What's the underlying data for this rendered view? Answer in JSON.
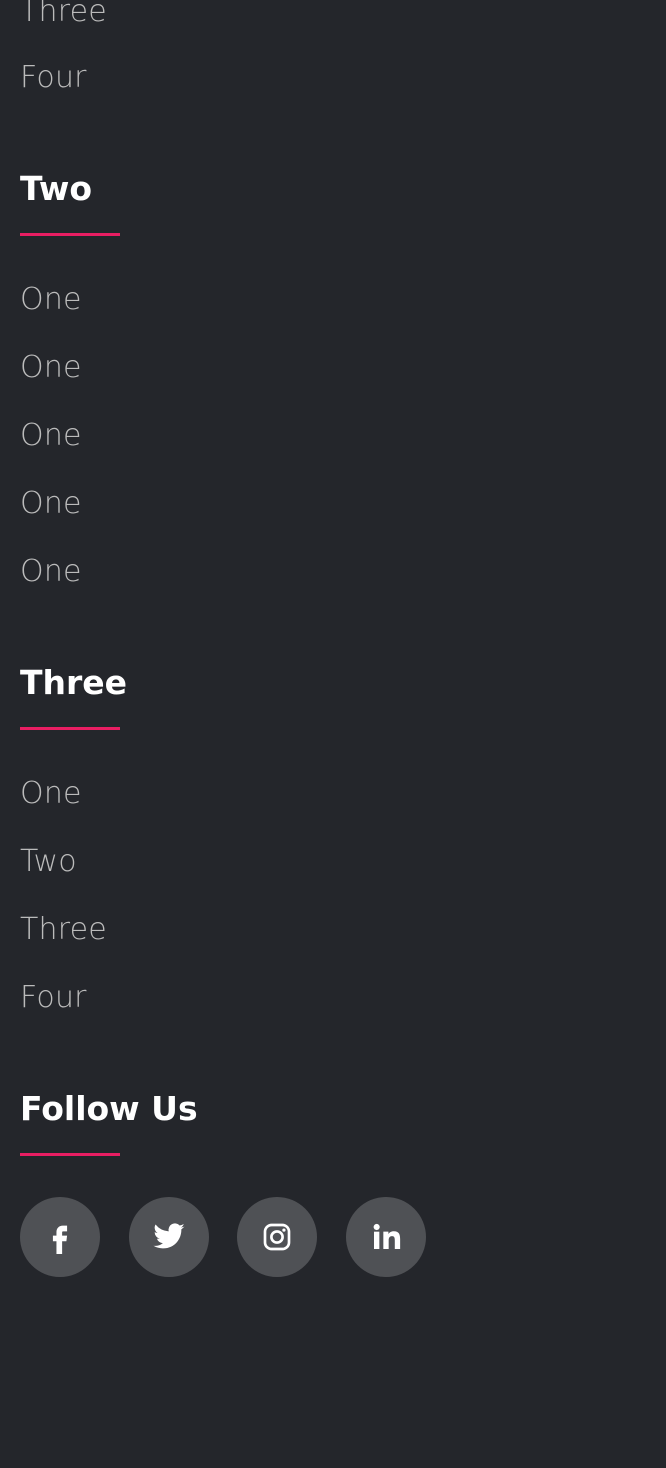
{
  "colors": {
    "background": "#24262b",
    "heading": "#ffffff",
    "link": "#bbbbbb",
    "accent": "#e91e63",
    "social_bg": "rgba(255,255,255,0.2)"
  },
  "sections": {
    "partial_list": [
      "Three",
      "Four"
    ],
    "two": {
      "title": "Two",
      "links": [
        "One",
        "One",
        "One",
        "One",
        "One"
      ]
    },
    "three": {
      "title": "Three",
      "links": [
        "One",
        "Two",
        "Three",
        "Four"
      ]
    },
    "follow": {
      "title": "Follow Us",
      "icons": [
        "facebook-icon",
        "twitter-icon",
        "instagram-icon",
        "linkedin-icon"
      ]
    }
  }
}
